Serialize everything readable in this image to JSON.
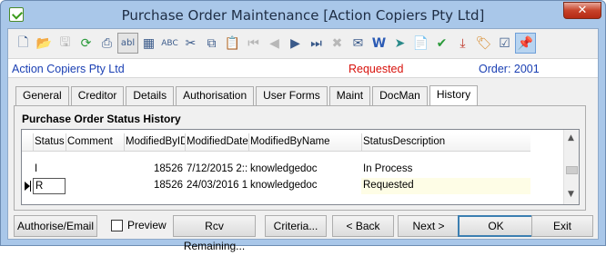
{
  "window": {
    "title": "Purchase Order Maintenance  [Action Copiers Pty Ltd]",
    "close_label": "✕"
  },
  "toolbar": {
    "icons": [
      "new-document",
      "open-folder",
      "save",
      "refresh",
      "print",
      "field-labels",
      "calculator",
      "spell-check",
      "cut",
      "copy",
      "paste",
      "first-record",
      "previous-record",
      "next-record",
      "last-record",
      "delete",
      "email",
      "word-export",
      "navigate",
      "clipboard-report",
      "approve",
      "download-tray",
      "tag",
      "checklist",
      "pin"
    ]
  },
  "info": {
    "company": "Action Copiers Pty Ltd",
    "status": "Requested",
    "order": "Order: 2001"
  },
  "tabs": [
    "General",
    "Creditor",
    "Details",
    "Authorisation",
    "User Forms",
    "Maint",
    "DocMan",
    "History"
  ],
  "active_tab": "History",
  "history": {
    "title": "Purchase Order Status History",
    "columns": [
      "Status",
      "Comment",
      "ModifiedByID",
      "ModifiedDate",
      "ModifiedByName",
      "StatusDescription"
    ],
    "rows": [
      {
        "status": "I",
        "comment": "",
        "modified_by_id": "18526",
        "modified_date": "7/12/2015 2::",
        "modified_by_name": "knowledgedoc",
        "status_description": "In Process"
      },
      {
        "status": "R",
        "comment": "",
        "modified_by_id": "18526",
        "modified_date": "24/03/2016 1",
        "modified_by_name": "knowledgedoc",
        "status_description": "Requested"
      }
    ]
  },
  "buttons": {
    "authorise": "Authorise/Email",
    "preview": "Preview",
    "receive": "Rcv Remaining...",
    "criteria": "Criteria...",
    "back": "< Back",
    "next": "Next >",
    "ok": "OK",
    "exit": "Exit"
  }
}
